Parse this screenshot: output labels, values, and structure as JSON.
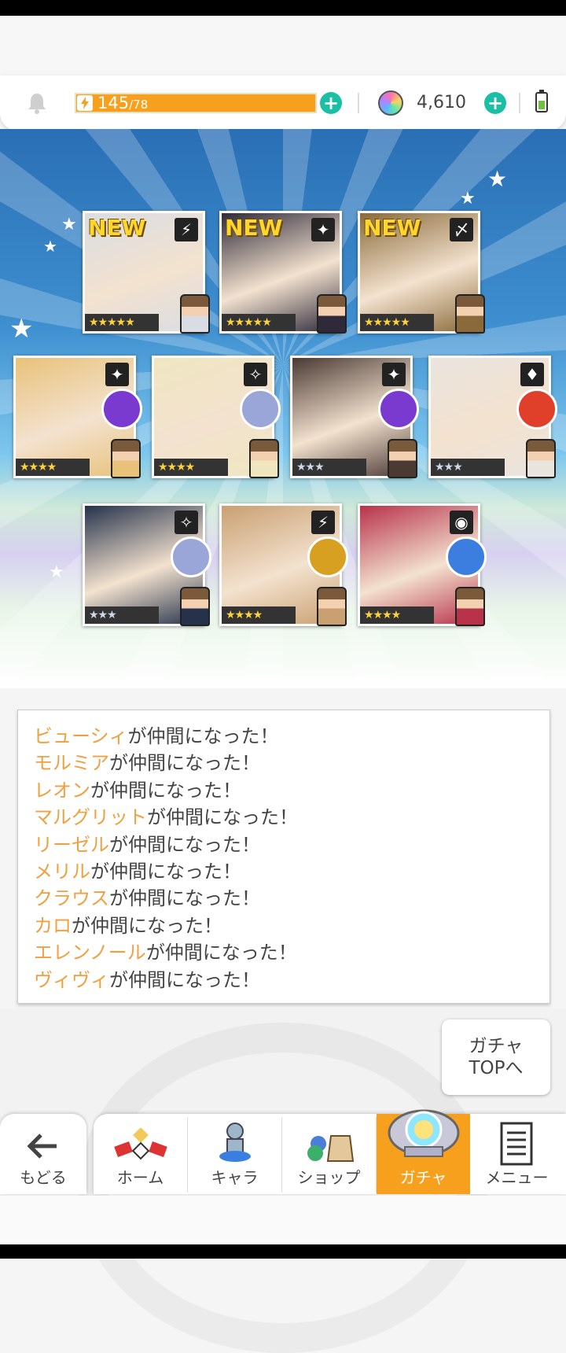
{
  "header": {
    "stamina_current": "145",
    "stamina_max": "/78",
    "gems": "4,610",
    "colors": {
      "accent": "#f7a01e",
      "plus": "#1bbfa6"
    }
  },
  "results": {
    "new_label": "NEW",
    "cards": [
      {
        "new": true,
        "rarity": "★★★★★",
        "element": "bolt-icon",
        "element_char": "⚡",
        "tone": "#d9dde3",
        "weapon": "none"
      },
      {
        "new": true,
        "rarity": "★★★★★",
        "element": "dark-star-icon",
        "element_char": "✦",
        "tone": "#2f2a3a",
        "weapon": "none"
      },
      {
        "new": true,
        "rarity": "★★★★★",
        "element": "leaf-icon",
        "element_char": "〆",
        "tone": "#8a6a3a",
        "weapon": "none"
      },
      {
        "new": false,
        "rarity": "★★★★",
        "element": "dark-star-icon",
        "element_char": "✦",
        "tone": "#e8c27a",
        "weapon": "purple"
      },
      {
        "new": false,
        "rarity": "★★★★",
        "element": "light-star-icon",
        "element_char": "✧",
        "tone": "#efe6c0",
        "weapon": "silver"
      },
      {
        "new": false,
        "rarity": "★★★",
        "element": "dark-star-icon",
        "element_char": "✦",
        "tone": "#4b3a34",
        "weapon": "purple"
      },
      {
        "new": false,
        "rarity": "★★★",
        "element": "fire-diamond-icon",
        "element_char": "♦",
        "tone": "#e9e4de",
        "weapon": "red"
      },
      {
        "new": false,
        "rarity": "★★★",
        "element": "light-star-icon",
        "element_char": "✧",
        "tone": "#25324a",
        "weapon": "silver"
      },
      {
        "new": false,
        "rarity": "★★★★",
        "element": "bolt-icon",
        "element_char": "⚡",
        "tone": "#c9a071",
        "weapon": "gold"
      },
      {
        "new": false,
        "rarity": "★★★★",
        "element": "water-circle-icon",
        "element_char": "◉",
        "tone": "#b8324a",
        "weapon": "blue"
      }
    ]
  },
  "log": {
    "suffix": "が仲間になった！",
    "names": [
      "ビューシィ",
      "モルミア",
      "レオン",
      "マルグリット",
      "リーゼル",
      "メリル",
      "クラウス",
      "カロ",
      "エレンノール",
      "ヴィヴィ"
    ]
  },
  "gacha_top_button": {
    "line1": "ガチャ",
    "line2": "TOPへ"
  },
  "nav": {
    "back": "もどる",
    "tabs": [
      "ホーム",
      "キャラ",
      "ショップ",
      "ガチャ",
      "メニュー"
    ],
    "active_tab": "ガチャ"
  }
}
